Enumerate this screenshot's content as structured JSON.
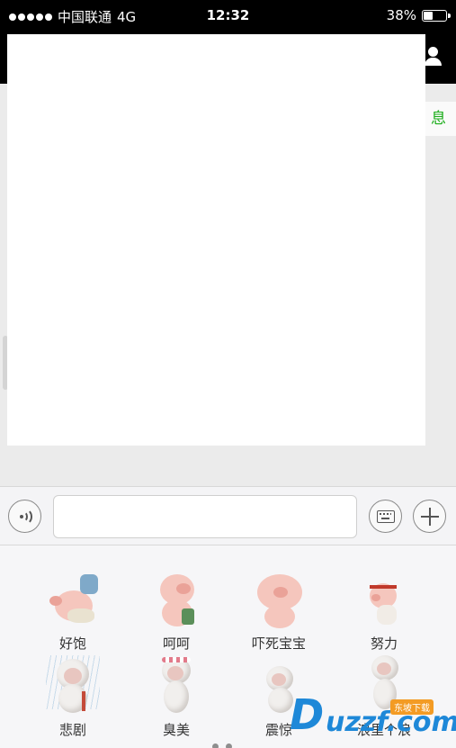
{
  "status_bar": {
    "carrier": "中国联通",
    "network": "4G",
    "time": "12:32",
    "battery_percent": "38%",
    "battery_level": 0.38
  },
  "nav": {
    "contact_icon": "person-icon"
  },
  "chat": {
    "notice_text": "息"
  },
  "input_bar": {
    "voice_icon": "voice-icon",
    "keyboard_icon": "keyboard-icon",
    "plus_icon": "plus-icon"
  },
  "stickers": [
    {
      "label": "好饱"
    },
    {
      "label": "呵呵"
    },
    {
      "label": "吓死宝宝"
    },
    {
      "label": "努力"
    },
    {
      "label": "悲剧"
    },
    {
      "label": "臭美"
    },
    {
      "label": "震惊"
    },
    {
      "label": "浪里个浪"
    }
  ],
  "watermark": {
    "logo_letter": "D",
    "site": "uzzf.com",
    "badge": "东坡下载"
  }
}
